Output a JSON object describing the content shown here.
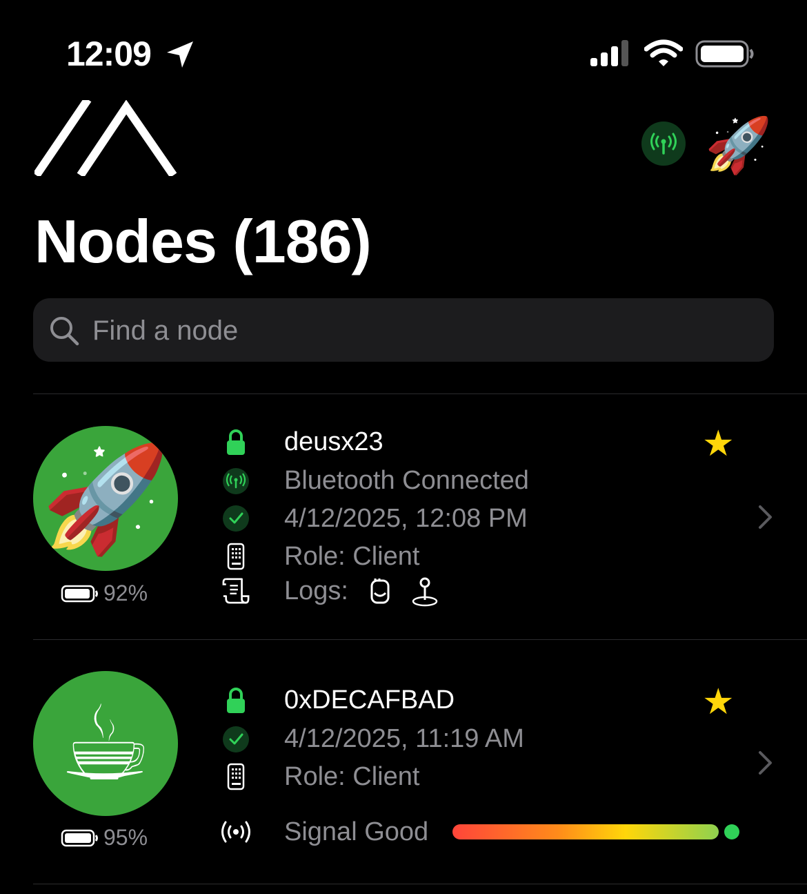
{
  "status_bar": {
    "time": "12:09"
  },
  "header": {
    "title": "Nodes (186)",
    "rocket_emoji": "🚀"
  },
  "search": {
    "placeholder": "Find a node"
  },
  "colors": {
    "accent": "#30d158",
    "avatar_bg": "#3aa53b",
    "star": "#ffd60a",
    "secondary_text": "#8e8e93"
  },
  "nodes": [
    {
      "emoji": "🚀",
      "battery": "92%",
      "name": "deusx23",
      "connection": "Bluetooth Connected",
      "last_heard": "4/12/2025, 12:08 PM",
      "role": "Role: Client",
      "logs_label": "Logs:",
      "favorite": true
    },
    {
      "emoji": "☕",
      "battery": "95%",
      "name": "0xDECAFBAD",
      "last_heard": "4/12/2025, 11:19 AM",
      "role": "Role: Client",
      "signal": "Signal Good",
      "favorite": true
    }
  ]
}
